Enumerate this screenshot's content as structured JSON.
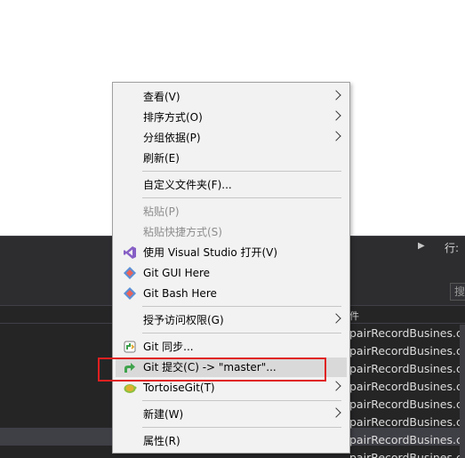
{
  "ide": {
    "row_label": "行:",
    "search_text": "搜",
    "column_header": "件",
    "files": [
      "pairRecordBusines.cs",
      "pairRecordBusines.cs",
      "pairRecordBusines.cs",
      "pairRecordBusines.cs",
      "pairRecordBusines.cs",
      "pairRecordBusines.cs",
      "pairRecordBusines.cs",
      "pairRecordBusines.cs"
    ]
  },
  "menu": {
    "items": [
      {
        "label": "查看(V)",
        "submenu": true,
        "enabled": true
      },
      {
        "label": "排序方式(O)",
        "submenu": true,
        "enabled": true
      },
      {
        "label": "分组依据(P)",
        "submenu": true,
        "enabled": true
      },
      {
        "label": "刷新(E)",
        "submenu": false,
        "enabled": true
      },
      {
        "label": "自定义文件夹(F)...",
        "submenu": false,
        "enabled": true
      },
      {
        "label": "粘贴(P)",
        "submenu": false,
        "enabled": false
      },
      {
        "label": "粘贴快捷方式(S)",
        "submenu": false,
        "enabled": false
      },
      {
        "label": "使用 Visual Studio 打开(V)",
        "submenu": false,
        "enabled": true,
        "icon": "visual-studio-icon"
      },
      {
        "label": "Git GUI Here",
        "submenu": false,
        "enabled": true,
        "icon": "git-gui-icon"
      },
      {
        "label": "Git Bash Here",
        "submenu": false,
        "enabled": true,
        "icon": "git-bash-icon"
      },
      {
        "label": "授予访问权限(G)",
        "submenu": true,
        "enabled": true
      },
      {
        "label": "Git 同步...",
        "submenu": false,
        "enabled": true,
        "icon": "git-sync-icon"
      },
      {
        "label": "Git 提交(C) -> \"master\"...",
        "submenu": false,
        "enabled": true,
        "icon": "git-commit-icon",
        "highlighted": true
      },
      {
        "label": "TortoiseGit(T)",
        "submenu": true,
        "enabled": true,
        "icon": "tortoisegit-icon"
      },
      {
        "label": "新建(W)",
        "submenu": true,
        "enabled": true
      },
      {
        "label": "属性(R)",
        "submenu": false,
        "enabled": true
      }
    ]
  },
  "colors": {
    "menu_bg": "#f2f2f2",
    "hover_bg": "#d9d9d9",
    "annotation_red": "#e02020",
    "ide_bg": "#252526"
  }
}
